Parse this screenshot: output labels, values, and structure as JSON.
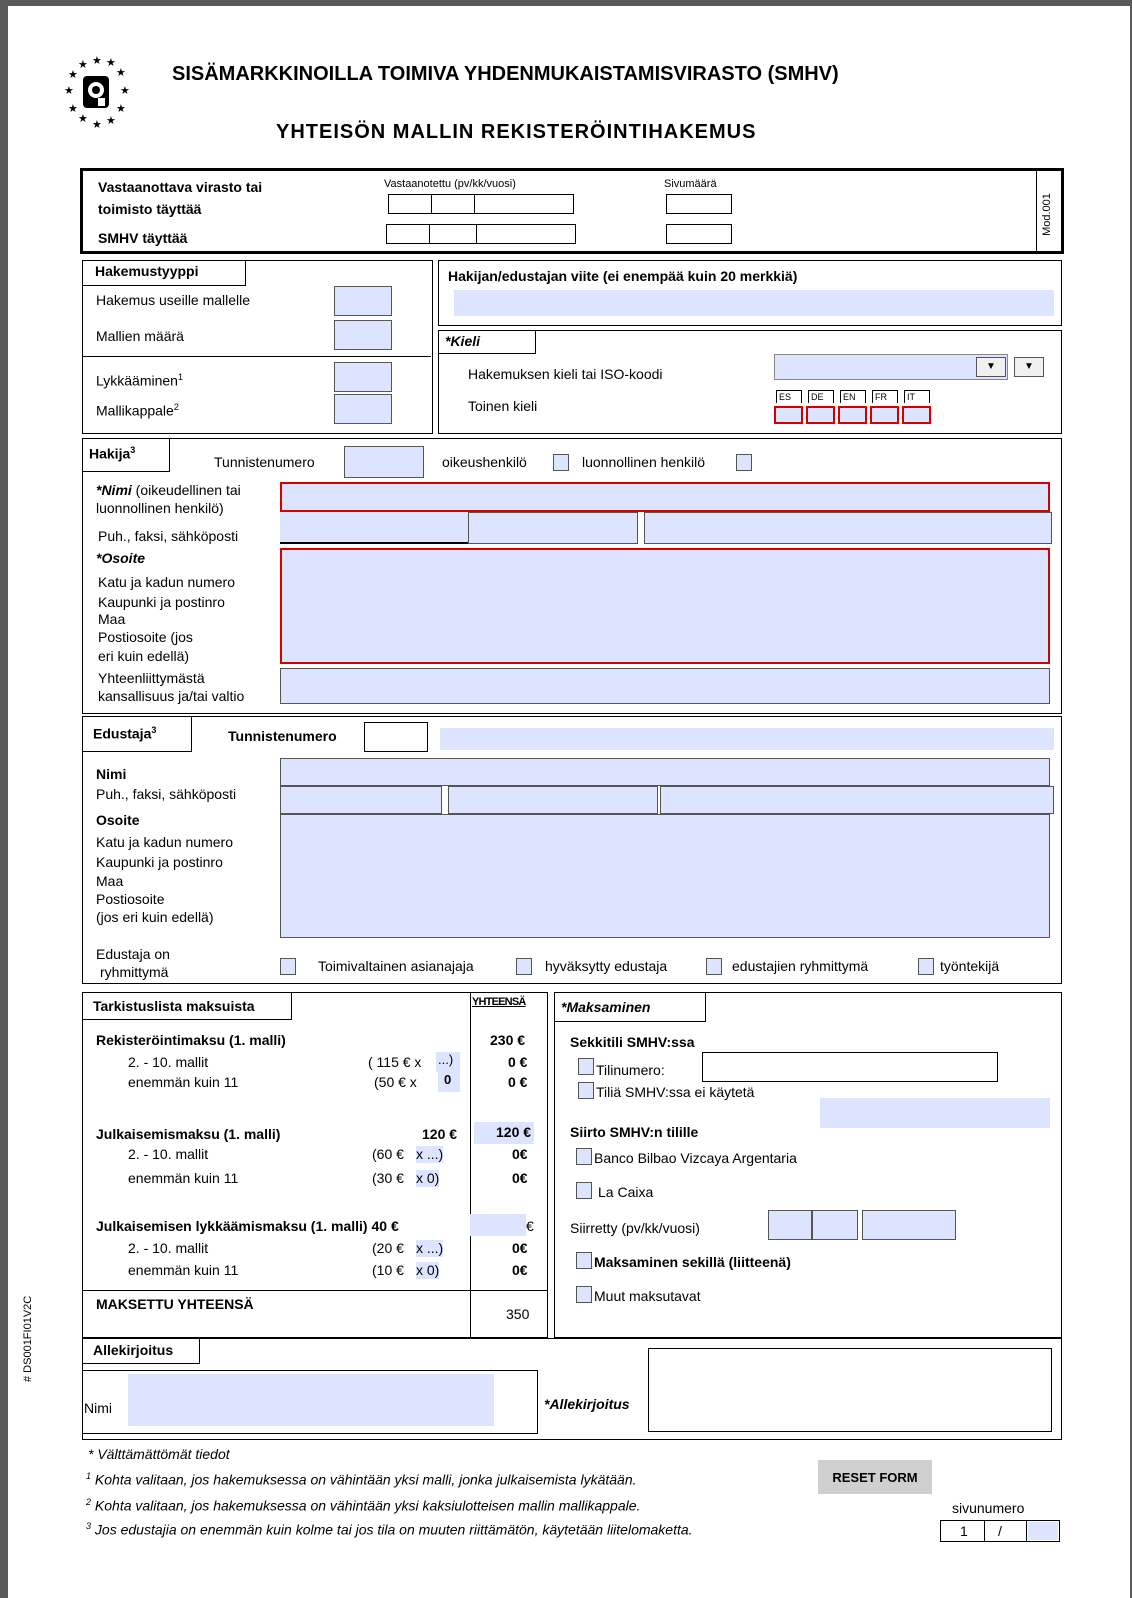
{
  "header": {
    "agency_title": "SISÄMARKKINOILLA TOIMIVA YHDENMUKAISTAMISVIRASTO (SMHV)",
    "form_title": "YHTEISÖN MALLIN REKISTERÖINTIHAKEMUS"
  },
  "office_block": {
    "receiving_office_label": "Vastaanottava virasto tai toimisto täyttää",
    "received_label": "Vastaanotettu (pv/kk/vuosi)",
    "page_count_label": "Sivumäärä",
    "smhv_label": "SMHV täyttää",
    "mod_code": "Mod.001"
  },
  "application_type": {
    "tab": "Hakemustyyppi",
    "multiple": "Hakemus useille mallelle",
    "count": "Mallien määrä",
    "deferment": "Lykkääminen",
    "deferment_sup": "1",
    "specimen": "Mallikappale",
    "specimen_sup": "2"
  },
  "reference": {
    "label": "Hakijan/edustajan viite  (ei enempää kuin 20 merkkiä)"
  },
  "language": {
    "tab": "*Kieli",
    "first": "Hakemuksen kieli tai ISO-koodi",
    "second": "Toinen kieli",
    "codes": [
      "ES",
      "DE",
      "EN",
      "FR",
      "IT"
    ]
  },
  "applicant": {
    "tab": "Hakija",
    "tab_sup": "3",
    "id_label": "Tunnistenumero",
    "legal_person": "oikeushenkilö",
    "natural_person": "luonnollinen henkilö",
    "name_bold": "*Nimi",
    "name_rest": " (oikeudellinen tai",
    "name_line2": "luonnollinen henkilö)",
    "contact": "Puh., faksi, sähköposti",
    "address_head": "*Osoite",
    "addr1": "Katu ja kadun numero",
    "addr2": "Kaupunki ja postinro",
    "addr3": "Maa",
    "addr4": "Postiosoite (jos",
    "addr5": "eri kuin edellä)",
    "nat1": "Yhteenliittymästä",
    "nat2": "kansallisuus ja/tai valtio"
  },
  "representative": {
    "tab": "Edustaja",
    "tab_sup": "3",
    "id_label": "Tunnistenumero",
    "name": "Nimi",
    "contact": "Puh., faksi, sähköposti",
    "address_head": "Osoite",
    "addr1": "Katu ja kadun numero",
    "addr2": "Kaupunki ja postinro",
    "addr3": "Maa",
    "addr4": "Postiosoite",
    "addr5": "(jos eri kuin edellä)",
    "group1": "Edustaja on",
    "group2": "ryhmittymä",
    "opt1": "Toimivaltainen asianajaja",
    "opt2": "hyväksytty edustaja",
    "opt3": "edustajien ryhmittymä",
    "opt4": "työntekijä"
  },
  "fees": {
    "tab": "Tarkistuslista maksuista",
    "total_col": "YHTEENSÄ",
    "reg_fee": "Rekisteröintimaksu (1. malli)",
    "reg_fee_total": "230 €",
    "r2_label": "2. - 10. mallit",
    "r2_calc": "( 115 € x",
    "r2_field": "...)",
    "r2_total": "0 €",
    "r3_label": "enemmän kuin 11",
    "r3_calc": "(50 € x",
    "r3_field": "0",
    "r3_total": "0 €",
    "pub_fee": "Julkaisemismaksu (1. malli)",
    "pub_fee_amount": "120 €",
    "pub_fee_total": "120 €",
    "p2_label": "2. - 10. mallit",
    "p2_calc": "(60 €",
    "p2_field": "x ...)",
    "p2_total": "0€",
    "p3_label": "enemmän kuin 11",
    "p3_calc": "(30 €",
    "p3_field": "x 0)",
    "p3_total": "0€",
    "def_fee": "Julkaisemisen lykkäämismaksu (1. malli) 40 €",
    "def_fee_total": "€",
    "d2_label": "2. - 10. mallit",
    "d2_calc": "(20 €",
    "d2_field": "x ...)",
    "d2_total": "0€",
    "d3_label": "enemmän kuin 11",
    "d3_calc": "(10 €",
    "d3_field": "x 0)",
    "d3_total": "0€",
    "paid_total_label": "MAKSETTU YHTEENSÄ",
    "paid_total": "350"
  },
  "payment": {
    "tab": "*Maksaminen",
    "current_account": "Sekkitili SMHV:ssa",
    "account_no": "Tilinumero:",
    "not_used": "Tiliä SMHV:ssa ei käytetä",
    "transfer": "Siirto SMHV:n tilille",
    "bank1": "Banco Bilbao Vizcaya Argentaria",
    "bank2": "La Caixa",
    "transferred": "Siirretty (pv/kk/vuosi)",
    "cheque": "Maksaminen sekillä (liitteenä)",
    "other": "Muut maksutavat"
  },
  "signature": {
    "tab": "Allekirjoitus",
    "name": "Nimi",
    "sig_label": "*Allekirjoitus"
  },
  "side_code": "# DS001FI01V2C",
  "footnotes": {
    "required": "* Välttämättömät tiedot",
    "n1_sup": "1",
    "n1": " Kohta valitaan, jos hakemuksessa on vähintään yksi malli, jonka julkaisemista lykätään.",
    "n2_sup": "2",
    "n2": " Kohta valitaan, jos hakemuksessa on vähintään yksi kaksiulotteisen mallin mallikappale.",
    "n3_sup": "3",
    "n3": " Jos edustajia on enemmän kuin kolme tai jos tila on muuten riittämätön, käytetään liitelomaketta."
  },
  "reset_button": "RESET FORM",
  "page_number": {
    "label": "sivunumero",
    "current": "1",
    "separator": "/"
  }
}
